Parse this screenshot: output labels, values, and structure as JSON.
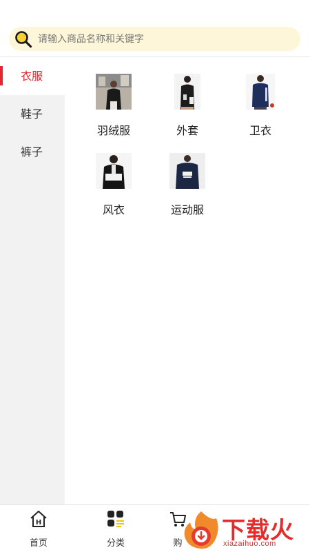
{
  "search": {
    "placeholder": "请输入商品名称和关键字",
    "bar_color": "#fdf6d8"
  },
  "sidebar": {
    "items": [
      {
        "label": "衣服",
        "active": true
      },
      {
        "label": "鞋子",
        "active": false
      },
      {
        "label": "裤子",
        "active": false
      }
    ],
    "active_color": "#e8262f"
  },
  "categories": [
    {
      "label": "羽绒服",
      "icon": "down-jacket-photo"
    },
    {
      "label": "外套",
      "icon": "coat-photo"
    },
    {
      "label": "卫衣",
      "icon": "sweatshirt-photo"
    },
    {
      "label": "风衣",
      "icon": "windbreaker-photo"
    },
    {
      "label": "运动服",
      "icon": "sportswear-photo"
    }
  ],
  "tabbar": {
    "tabs": [
      {
        "label": "首页",
        "icon": "home-icon"
      },
      {
        "label": "分类",
        "icon": "category-icon"
      },
      {
        "label": "购",
        "icon": "cart-icon"
      }
    ]
  }
}
